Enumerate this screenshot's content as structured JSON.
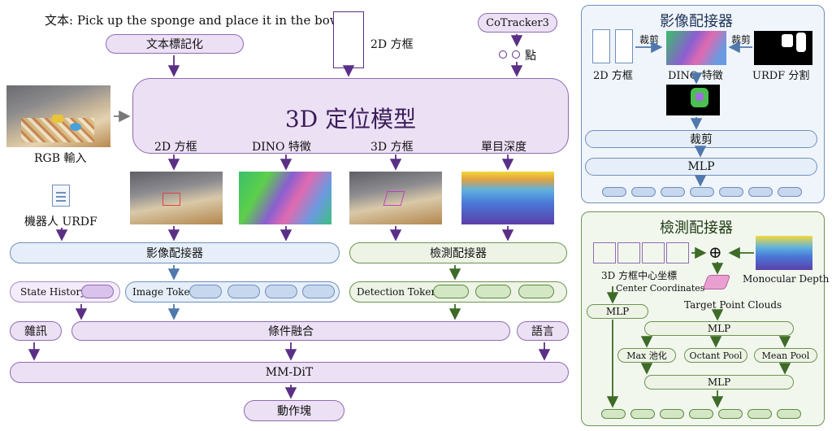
{
  "text_prompt": "文本: Pick up the sponge and place it in the bowl.",
  "text_tokenize": "文本標記化",
  "box2d_top": "2D 方框",
  "cotracker": "CoTracker3",
  "points": "點",
  "rgb_input": "RGB 輸入",
  "model": {
    "title": "3D 定位模型",
    "outputs": [
      "2D 方框",
      "DINO 特徵",
      "3D 方框",
      "單目深度"
    ]
  },
  "robot_urdf": "機器人 URDF",
  "image_adapter": "影像配接器",
  "detection_adapter": "檢測配接器",
  "state_history": "State History",
  "image_token": "Image Token",
  "detection_token": "Detection Token",
  "noise": "雜訊",
  "cond_fusion": "條件融合",
  "language": "語言",
  "mmdit": "MM-DiT",
  "action_chunk": "動作塊",
  "panel_image": {
    "title": "影像配接器",
    "crop_left": "裁剪",
    "crop_right": "裁剪",
    "box2d": "2D 方框",
    "dino": "DINO 特徵",
    "urdf_seg": "URDF 分割",
    "crop": "裁剪",
    "mlp": "MLP"
  },
  "panel_detect": {
    "title": "檢測配接器",
    "center_cn": "3D 方框中心坐標",
    "center_en": "Center Coordinates",
    "plus": "⊕",
    "mono_depth": "Monocular Depth",
    "target_pc": "Target Point Clouds",
    "mlp_left": "MLP",
    "mlp_top": "MLP",
    "max_pool": "Max 池化",
    "octant_pool": "Octant Pool",
    "mean_pool": "Mean Pool",
    "mlp_bottom": "MLP"
  },
  "colors": {
    "purple": "#8f6bb0",
    "blue": "#6f8fbd",
    "green": "#6d9450",
    "arrow_purple": "#5b2f86",
    "arrow_blue": "#4f78ad",
    "arrow_green": "#3e6b27"
  }
}
